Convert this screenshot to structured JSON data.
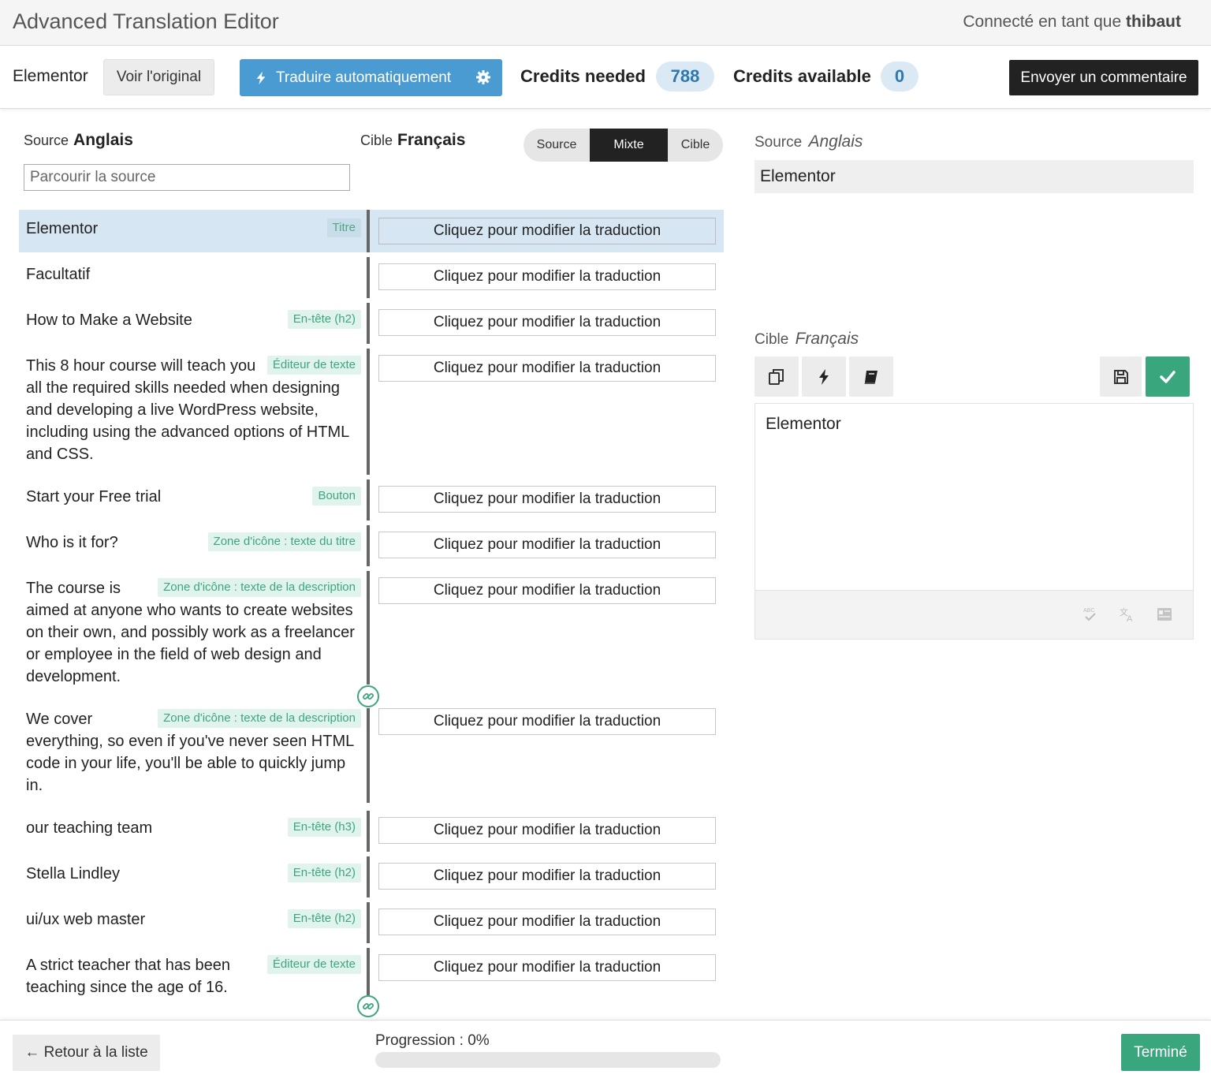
{
  "window": {
    "title": "Advanced Translation Editor",
    "user_prefix": "Connecté en tant que",
    "user_name": "thibaut"
  },
  "toolbar": {
    "doc_name": "Elementor",
    "view_original": "Voir l'original",
    "auto_translate": "Traduire automatiquement",
    "credits_needed_label": "Credits needed",
    "credits_needed": "788",
    "credits_available_label": "Credits available",
    "credits_available": "0",
    "feedback": "Envoyer un commentaire"
  },
  "columns": {
    "source_label": "Source",
    "source_lang": "Anglais",
    "target_label": "Cible",
    "target_lang": "Français",
    "search_placeholder": "Parcourir la source",
    "view_modes": [
      "Source",
      "Mixte",
      "Cible"
    ],
    "active_mode": "Mixte"
  },
  "rows": [
    {
      "text": "Elementor",
      "tag": "Titre",
      "target": "Cliquez pour modifier la traduction",
      "selected": true
    },
    {
      "text": "Facultatif",
      "tag": "",
      "target": "Cliquez pour modifier la traduction"
    },
    {
      "text": "How to Make a Website",
      "tag": "En-tête (h2)",
      "target": "Cliquez pour modifier la traduction"
    },
    {
      "text": "This 8 hour course will teach you all the required skills needed when designing and developing a live WordPress website, including using the advanced options of HTML and CSS.",
      "tag": "Éditeur de texte",
      "target": "Cliquez pour modifier la traduction"
    },
    {
      "text": "Start your Free trial",
      "tag": "Bouton",
      "target": "Cliquez pour modifier la traduction"
    },
    {
      "text": "Who is it for?",
      "tag": "Zone d'icône : texte du titre",
      "target": "Cliquez pour modifier la traduction"
    },
    {
      "text": "The course is aimed at anyone who wants to create websites on their own, and possibly work as a freelancer or employee in the field of web design and development.",
      "tag": "Zone d'icône : texte de la description",
      "target": "Cliquez pour modifier la traduction"
    },
    {
      "text": "We cover everything, so even if you've never seen HTML code in your life, you'll be able to quickly jump in.",
      "tag": "Zone d'icône : texte de la description",
      "target": "Cliquez pour modifier la traduction"
    },
    {
      "text": "our teaching team",
      "tag": "En-tête (h3)",
      "target": "Cliquez pour modifier la traduction"
    },
    {
      "text": "Stella Lindley",
      "tag": "En-tête (h2)",
      "target": "Cliquez pour modifier la traduction"
    },
    {
      "text": "ui/ux web master",
      "tag": "En-tête (h2)",
      "target": "Cliquez pour modifier la traduction"
    },
    {
      "text": "A strict teacher that has been teaching since the age of 16.",
      "tag": "Éditeur de texte",
      "target": "Cliquez pour modifier la traduction"
    }
  ],
  "panel": {
    "source_label": "Source",
    "source_lang": "Anglais",
    "source_text": "Elementor",
    "target_label": "Cible",
    "target_lang": "Français",
    "target_text": "Elementor",
    "tool_icons": [
      "copy-icon",
      "bolt-icon",
      "glossary-book-icon",
      "save-icon",
      "check-icon"
    ],
    "footer_icons": [
      "spellcheck-icon",
      "translate-icon",
      "glossary-icon"
    ]
  },
  "footer": {
    "back": "← Retour à la liste",
    "progress_label": "Progression : 0%",
    "progress": 0,
    "done": "Terminé"
  },
  "colors": {
    "accent_blue": "#4a9bd1",
    "success_green": "#3aa67d",
    "tag_green": "#3ea67f",
    "selected_row": "#d6e6f3"
  }
}
